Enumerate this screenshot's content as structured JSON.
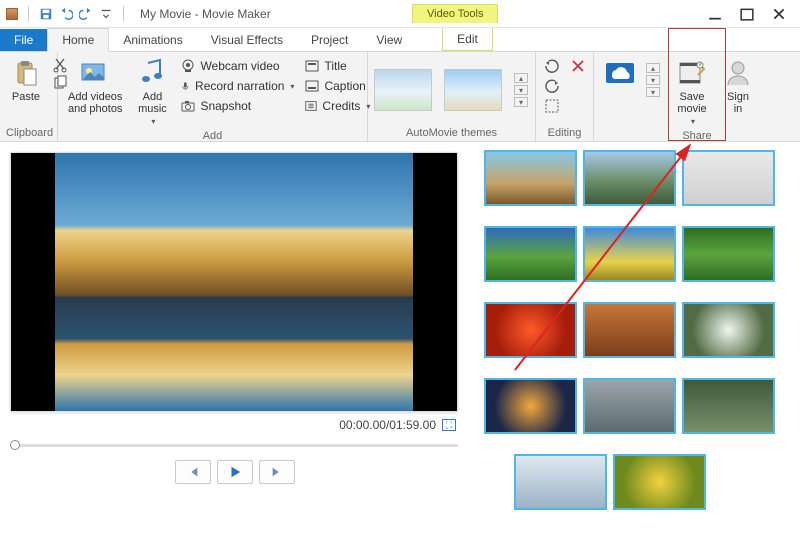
{
  "titlebar": {
    "title": "My Movie - Movie Maker",
    "context_tab": "Video Tools"
  },
  "tabs": {
    "file": "File",
    "home": "Home",
    "animations": "Animations",
    "visual_effects": "Visual Effects",
    "project": "Project",
    "view": "View",
    "edit": "Edit"
  },
  "ribbon": {
    "clipboard": {
      "label": "Clipboard",
      "paste": "Paste"
    },
    "add": {
      "label": "Add",
      "add_videos": "Add videos\nand photos",
      "add_music": "Add\nmusic",
      "webcam": "Webcam video",
      "record": "Record narration",
      "snapshot": "Snapshot",
      "title": "Title",
      "caption": "Caption",
      "credits": "Credits"
    },
    "automovie": {
      "label": "AutoMovie themes"
    },
    "editing": {
      "label": "Editing"
    },
    "share": {
      "label": "Share",
      "save_movie": "Save\nmovie",
      "sign_in": "Sign\nin"
    }
  },
  "player": {
    "time": "00:00.00/01:59.00"
  }
}
